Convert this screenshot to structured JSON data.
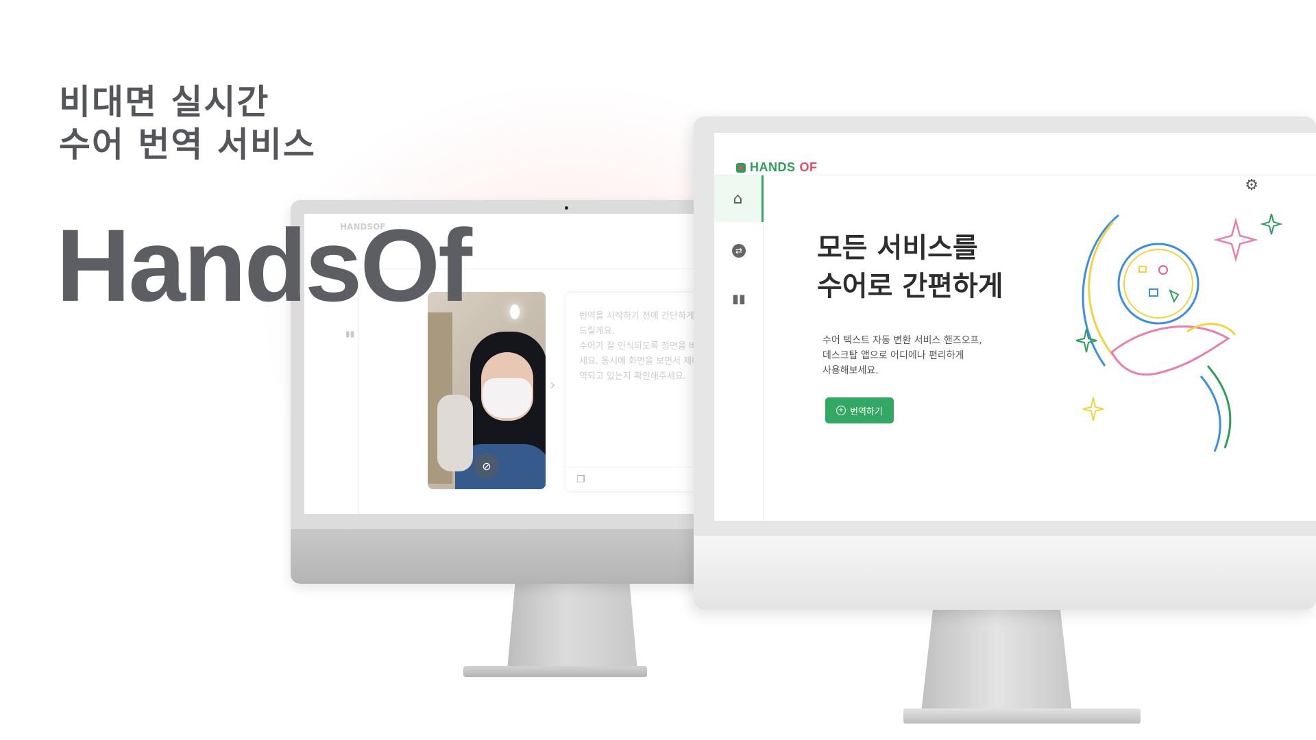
{
  "headline": {
    "line1": "비대면 실시간",
    "line2": "수어 번역 서비스"
  },
  "brand_name": "HandsOf",
  "back_monitor": {
    "logo_text": "HANDSOF",
    "translation_placeholder": "번역을 시작하기 전에 간단하게 안내해드릴게요.\n수어가 잘 인식되도록 정면을 바라봐주세요. 동시에 화면을 보면서 제대로 번역되고 있는지 확인해주세요."
  },
  "app": {
    "logo_part1": "HANDS",
    "logo_part2": "OF",
    "hero_title_line1": "모든 서비스를",
    "hero_title_line2": "수어로 간편하게",
    "hero_desc_line1": "수어 텍스트 자동 변환 서비스 핸즈오프,",
    "hero_desc_line2": "데스크탑 앱으로 어디에나 편리하게",
    "hero_desc_line3": "사용해보세요.",
    "cta_label": "번역하기"
  },
  "icons": {
    "home": "home-icon",
    "translate": "swap-icon",
    "stats": "bar-chart-icon",
    "settings": "gear-icon",
    "copy": "copy-icon",
    "camera_off": "camera-off-icon"
  },
  "colors": {
    "brand_green": "#33a865",
    "brand_red": "#e74c5f",
    "headline_gray": "#55565c"
  }
}
